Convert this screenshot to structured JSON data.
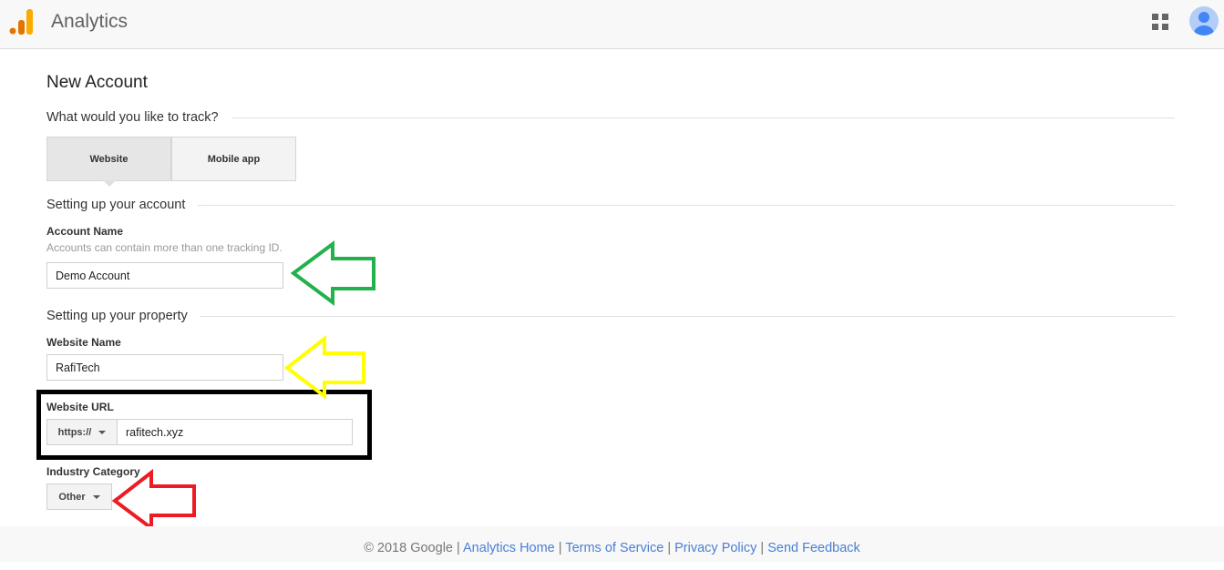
{
  "header": {
    "title": "Analytics",
    "logo": "google-analytics-logo",
    "apps_icon": "apps-grid-icon",
    "avatar_icon": "account-avatar-icon"
  },
  "page": {
    "title": "New Account",
    "track_question": "What would you like to track?",
    "tabs": [
      {
        "label": "Website",
        "selected": true
      },
      {
        "label": "Mobile app",
        "selected": false
      }
    ],
    "account_section": "Setting up your account",
    "account_name_label": "Account Name",
    "account_name_hint": "Accounts can contain more than one tracking ID.",
    "account_name_value": "Demo Account",
    "property_section": "Setting up your property",
    "website_name_label": "Website Name",
    "website_name_value": "RafiTech",
    "website_url_label": "Website URL",
    "protocol": "https://",
    "website_url_value": "rafitech.xyz",
    "industry_label": "Industry Category",
    "industry_value": "Other"
  },
  "annotations": {
    "colors": {
      "account_arrow": "#22b14c",
      "website_name_arrow": "#ffff00",
      "url_box": "#000000",
      "industry_arrow": "#ed1c24"
    }
  },
  "footer": {
    "copyright": "© 2018 Google",
    "sep": " | ",
    "links": [
      "Analytics Home",
      "Terms of Service",
      "Privacy Policy",
      "Send Feedback"
    ]
  }
}
